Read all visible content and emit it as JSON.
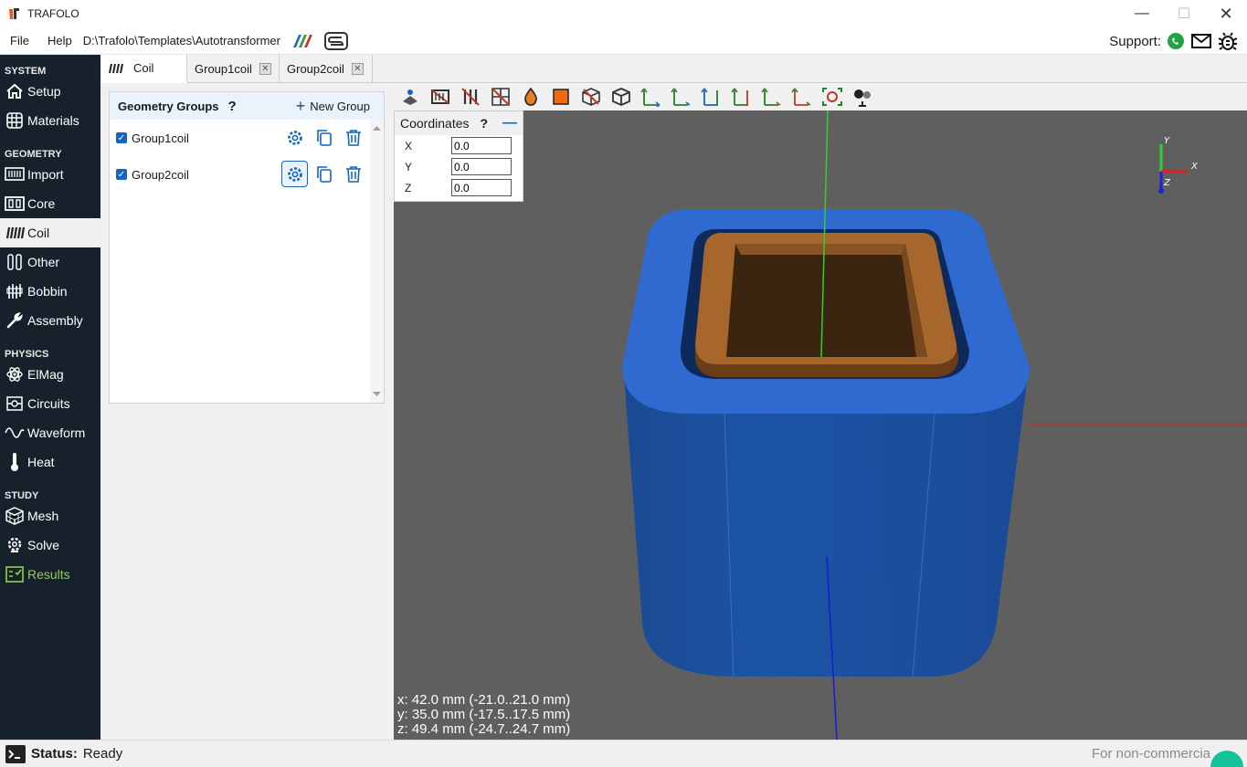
{
  "app": {
    "title": "TRAFOLO"
  },
  "menu": {
    "file": "File",
    "help": "Help",
    "path": "D:\\Trafolo\\Templates\\Autotransformer"
  },
  "support": {
    "label": "Support:"
  },
  "sidebar": {
    "system": "SYSTEM",
    "setup": "Setup",
    "materials": "Materials",
    "geometry": "GEOMETRY",
    "import": "Import",
    "core": "Core",
    "coil": "Coil",
    "other": "Other",
    "bobbin": "Bobbin",
    "assembly": "Assembly",
    "physics": "PHYSICS",
    "elmag": "ElMag",
    "circuits": "Circuits",
    "waveform": "Waveform",
    "heat": "Heat",
    "study": "STUDY",
    "mesh": "Mesh",
    "solve": "Solve",
    "results": "Results"
  },
  "tabs": {
    "coil": "Coil",
    "group1": "Group1coil",
    "group2": "Group2coil"
  },
  "panel": {
    "title": "Geometry Groups",
    "help": "?",
    "new_group": "New Group",
    "groups": [
      {
        "name": "Group1coil"
      },
      {
        "name": "Group2coil"
      }
    ]
  },
  "toolbar": {
    "x_neg": "-X",
    "x_pos": "+X",
    "y_neg": "-Y",
    "y_pos": "+Y",
    "z_neg": "-Z",
    "z_pos": "+Z"
  },
  "coordinates": {
    "title": "Coordinates",
    "help": "?",
    "x_label": "X",
    "y_label": "Y",
    "z_label": "Z",
    "x": "0.0",
    "y": "0.0",
    "z": "0.0"
  },
  "axes": {
    "x": "X",
    "y": "Y",
    "z": "Z"
  },
  "dimensions": {
    "x": "x: 42.0 mm (-21.0..21.0 mm)",
    "y": "y: 35.0 mm (-17.5..17.5 mm)",
    "z": "z: 49.4 mm (-24.7..24.7 mm)"
  },
  "status": {
    "label": "Status:",
    "value": "Ready",
    "license": "For non-commercia"
  },
  "colors": {
    "sidebar_bg": "#17212b",
    "accent": "#1565c0",
    "core_blue": "#1f57a8",
    "coil_copper": "#a0622b",
    "viewport_bg": "#5f5f5f"
  }
}
